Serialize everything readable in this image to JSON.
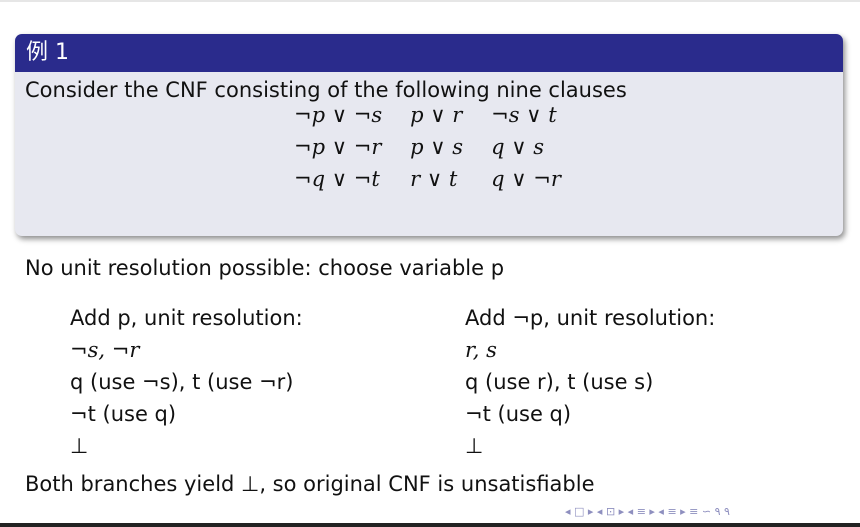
{
  "block": {
    "title": "例 1",
    "intro": "Consider the CNF consisting of the following nine clauses",
    "clauses": [
      [
        "¬p ∨ ¬s",
        "p ∨ r",
        "¬s ∨ t"
      ],
      [
        "¬p ∨ ¬r",
        "p ∨ s",
        "q ∨ s"
      ],
      [
        "¬q ∨ ¬t",
        "r ∨ t",
        "q ∨ ¬r"
      ]
    ]
  },
  "main": {
    "no_unit": "No unit resolution possible: choose variable p",
    "left": [
      "Add p, unit resolution:",
      "¬s, ¬r",
      "q (use ¬s), t (use ¬r)",
      "¬t (use q)",
      "⊥"
    ],
    "right": [
      "Add ¬p, unit resolution:",
      "r, s",
      "q (use r), t (use s)",
      "¬t (use q)",
      "⊥"
    ],
    "conclusion": "Both branches yield ⊥, so original CNF is unsatisfiable"
  },
  "nav": {
    "symbols": "◂ □ ▸ ◂ ⊡ ▸ ◂ ≡ ▸ ◂ ≡ ▸  ≡  ∽ ۹ ۹"
  }
}
